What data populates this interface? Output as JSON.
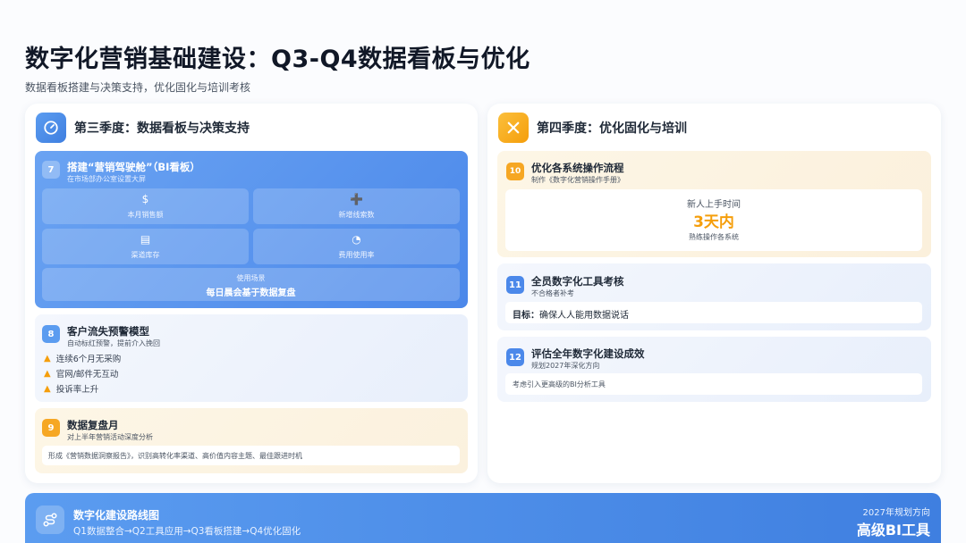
{
  "header": {
    "title": "数字化营销基础建设：Q3-Q4数据看板与优化",
    "subtitle": "数据看板搭建与决策支持，优化固化与培训考核"
  },
  "q3": {
    "title": "第三季度：数据看板与决策支持",
    "icon": "gauge-icon",
    "card7": {
      "num": "7",
      "title": "搭建“营销驾驶舱”（BI看板）",
      "sub": "在市场部办公室设置大屏",
      "tiles": [
        {
          "icon": "$",
          "label": "本月销售额"
        },
        {
          "icon": "➕",
          "label": "新增线索数"
        },
        {
          "icon": "▤",
          "label": "渠道库存"
        },
        {
          "icon": "◔",
          "label": "费用使用率"
        }
      ],
      "scene_label": "使用场景",
      "scene_text": "每日晨会基于数据复盘"
    },
    "card8": {
      "num": "8",
      "title": "客户流失预警模型",
      "sub": "自动标红预警，提前介入挽回",
      "warnings": [
        "连续6个月无采购",
        "官网/邮件无互动",
        "投诉率上升"
      ]
    },
    "card9": {
      "num": "9",
      "title": "数据复盘月",
      "sub": "对上半年营销活动深度分析",
      "note": "形成《营销数据洞察报告》，识别高转化率渠道、高价值内容主题、最佳跟进时机"
    }
  },
  "q4": {
    "title": "第四季度：优化固化与培训",
    "icon": "tools-icon",
    "card10": {
      "num": "10",
      "title": "优化各系统操作流程",
      "sub": "制作《数字化营销操作手册》",
      "metric_label": "新人上手时间",
      "metric_value": "3天内",
      "metric_note": "熟练操作各系统"
    },
    "card11": {
      "num": "11",
      "title": "全员数字化工具考核",
      "sub": "不合格者补考",
      "goal_label": "目标：",
      "goal_text": "确保人人能用数据说话"
    },
    "card12": {
      "num": "12",
      "title": "评估全年数字化建设成效",
      "sub": "规划2027年深化方向",
      "note": "考虑引入更高级的BI分析工具"
    }
  },
  "banner": {
    "title": "数字化建设路线图",
    "path": "Q1数据整合→Q2工具应用→Q3看板搭建→Q4优化固化",
    "right_label": "2027年规划方向",
    "right_value": "高级BI工具"
  },
  "colors": {
    "accent_blue": "#4b88ea",
    "accent_orange": "#f6a723"
  }
}
